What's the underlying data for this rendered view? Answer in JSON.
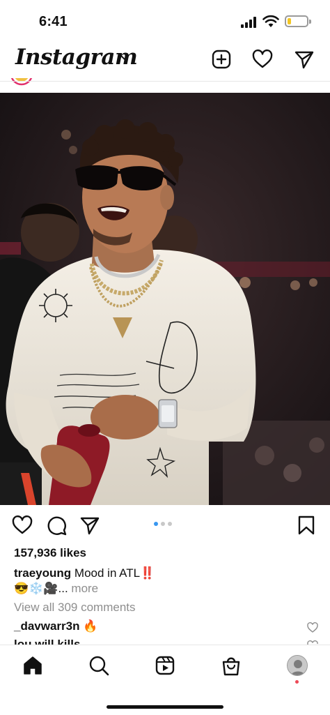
{
  "status_bar": {
    "time": "6:41",
    "battery_level": 0.2,
    "battery_color": "#f3c623"
  },
  "header": {
    "logo": "Instagram",
    "icons": [
      "chevron-down-icon",
      "new-post-icon",
      "heart-icon",
      "direct-message-icon"
    ]
  },
  "post": {
    "carousel": {
      "count": 3,
      "active_index": 0,
      "active_color": "#3897f0"
    },
    "actions": [
      "like-icon",
      "comment-icon",
      "share-icon",
      "save-icon"
    ],
    "likes": "157,936 likes",
    "caption_user": "traeyoung",
    "caption_text": "Mood in ATL‼️",
    "caption_line2": "😎❄️🎥...",
    "more": "more",
    "view_comments": "View all 309 comments",
    "comments": [
      {
        "user": "_davwarr3n",
        "text": "🔥"
      },
      {
        "user": "lou.will.kills",
        "text": ""
      }
    ]
  },
  "tab_bar": {
    "items": [
      "home-icon",
      "search-icon",
      "reels-icon",
      "shop-icon",
      "profile-avatar"
    ],
    "active": "home-icon",
    "notification_color": "#ed4956"
  }
}
